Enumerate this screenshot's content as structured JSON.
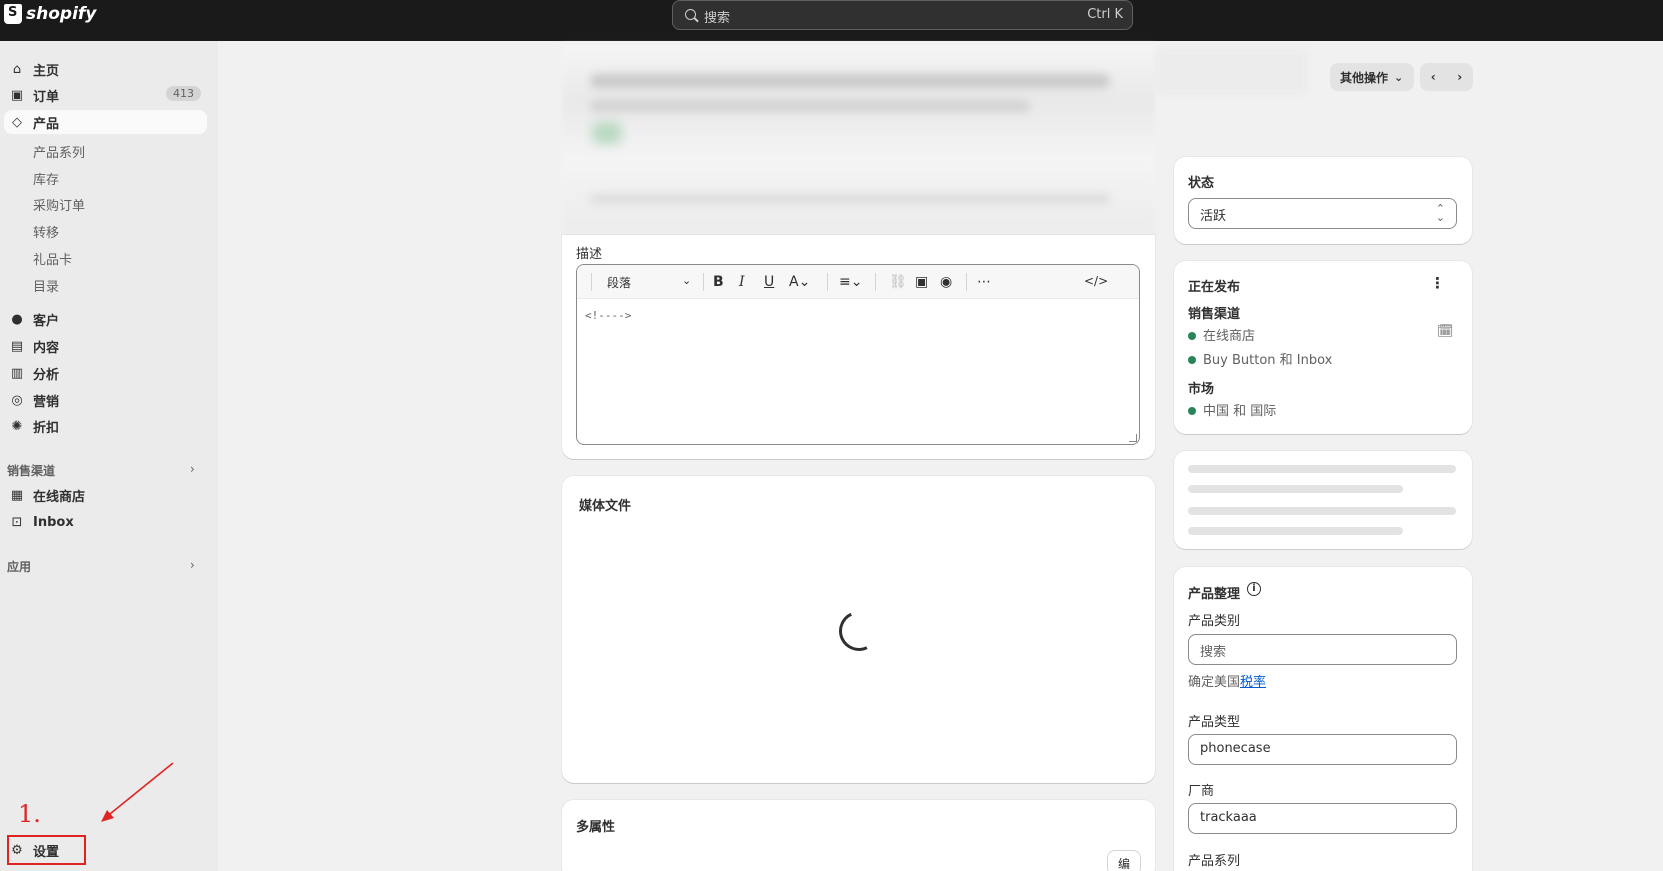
{
  "topbar": {
    "brand": "shopify",
    "search_placeholder": "搜索",
    "shortcut": "Ctrl K"
  },
  "sidebar": {
    "items": [
      {
        "label": "主页",
        "icon": "home-icon"
      },
      {
        "label": "订单",
        "icon": "inbox-icon",
        "badge": "413"
      },
      {
        "label": "产品",
        "icon": "tag-icon",
        "active": true
      },
      {
        "label": "客户",
        "icon": "person-icon"
      },
      {
        "label": "内容",
        "icon": "content-icon"
      },
      {
        "label": "分析",
        "icon": "bar-chart-icon"
      },
      {
        "label": "营销",
        "icon": "target-icon"
      },
      {
        "label": "折扣",
        "icon": "discount-icon"
      }
    ],
    "product_sub_items": [
      "产品系列",
      "库存",
      "采购订单",
      "转移",
      "礼品卡",
      "目录"
    ],
    "sales_channels_label": "销售渠道",
    "sales_channels": [
      {
        "label": "在线商店",
        "icon": "store-icon"
      },
      {
        "label": "Inbox",
        "icon": "inbox-app-icon"
      }
    ],
    "apps_label": "应用",
    "settings_label": "设置",
    "annotation_number": "1."
  },
  "header_actions": {
    "more_actions": "其他操作"
  },
  "description": {
    "label": "描述",
    "paragraph_select": "段落",
    "content": "<!---->"
  },
  "media": {
    "title": "媒体文件"
  },
  "variants": {
    "title": "多属性",
    "edit_button": "编"
  },
  "status": {
    "title": "状态",
    "value": "活跃"
  },
  "publishing": {
    "title": "正在发布",
    "channels_label": "销售渠道",
    "channels": [
      "在线商店",
      "Buy Button 和 Inbox"
    ],
    "markets_label": "市场",
    "markets": [
      "中国 和 国际"
    ]
  },
  "organization": {
    "title": "产品整理",
    "category_label": "产品类别",
    "category_placeholder": "搜索",
    "tax_prefix": "确定美国",
    "tax_link": "税率",
    "type_label": "产品类型",
    "type_value": "phonecase",
    "vendor_label": "厂商",
    "vendor_value": "trackaaa",
    "collections_label": "产品系列"
  },
  "colors": {
    "accent_green": "#29845a",
    "annotation_red": "#e02424",
    "topbar": "#1a1a1a"
  }
}
